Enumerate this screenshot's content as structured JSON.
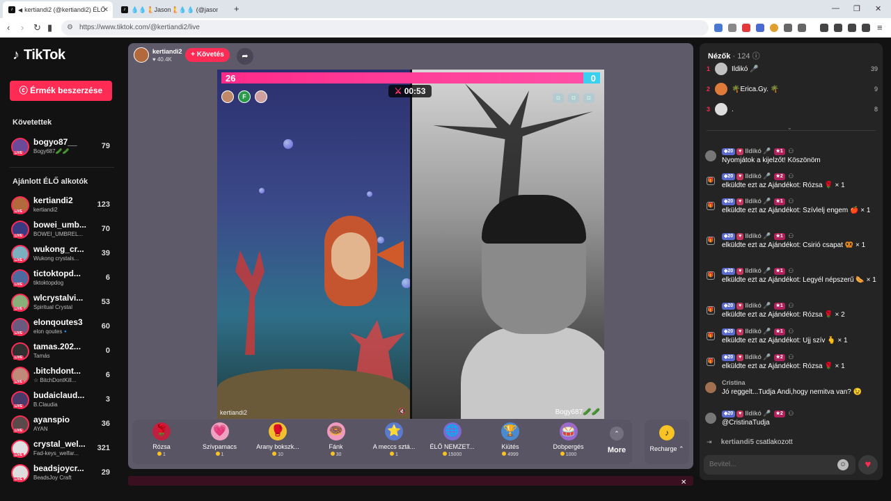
{
  "browser": {
    "tabs": [
      {
        "title": "kertiandi2 (@kertiandi2) ÉLŐ",
        "active": true
      },
      {
        "title": "💧💧🧜Jason🧜💧💧 (@jason_sam",
        "active": false
      }
    ],
    "new_tab": "+",
    "url": "https://www.tiktok.com/@kertiandi2/live",
    "win_min": "—",
    "win_max": "❐",
    "win_close": "✕"
  },
  "sidebar": {
    "logo": "TikTok",
    "coins_button": "Érmék beszerzése",
    "following_title": "Követettek",
    "following": [
      {
        "name": "bogyo87__",
        "sub": "Bogy687🥒🥒",
        "count": "79",
        "color": "#6c4a9a"
      }
    ],
    "recommended_title": "Ajánlott ÉLŐ alkotók",
    "recommended": [
      {
        "name": "kertiandi2",
        "sub": "kertiandi2",
        "count": "123",
        "color": "#b26a3c"
      },
      {
        "name": "bowei_umb...",
        "sub": "BOWEI_UMBREL...",
        "count": "70",
        "color": "#3a3a80"
      },
      {
        "name": "wukong_cr...",
        "sub": "Wukong crystals...",
        "count": "39",
        "color": "#7ab0c0"
      },
      {
        "name": "tictoktopd...",
        "sub": "tiktoktopdog",
        "count": "6",
        "color": "#4a6aa0"
      },
      {
        "name": "wlcrystalvi...",
        "sub": "Spiritual Crystal",
        "count": "53",
        "color": "#8ab07a"
      },
      {
        "name": "elonqoutes3",
        "sub": "elon qoutes🔹",
        "count": "60",
        "color": "#6a5a80"
      },
      {
        "name": "tamas.202...",
        "sub": "Tamás",
        "count": "0",
        "color": "#303030"
      },
      {
        "name": ".bitchdont...",
        "sub": "☆ BitchDontKill...",
        "count": "6",
        "color": "#c08a7a"
      },
      {
        "name": "budaiclaud...",
        "sub": "B.Claudia",
        "count": "3",
        "color": "#4a3a6a"
      },
      {
        "name": "ayanspio",
        "sub": "AYAN",
        "count": "36",
        "color": "#5a4a4a"
      },
      {
        "name": "crystal_wel...",
        "sub": "Fad-keys_welfar...",
        "count": "321",
        "color": "#e0e0e0"
      },
      {
        "name": "beadsjoycr...",
        "sub": "BeadsJoy Craft",
        "count": "29",
        "color": "#ddd"
      }
    ]
  },
  "stream": {
    "host_name": "kertiandi2",
    "host_likes": "♥ 40.4K",
    "follow_label": "+ Követés",
    "share_icon": "➦",
    "score_left": "26",
    "score_right": "0",
    "pink_fraction": 0.955,
    "timer": "00:53",
    "timer_icon": "⚔",
    "left_label": "kertiandi2",
    "right_label": "Bogy687🥒🥒",
    "mini_avatars": [
      "",
      "F",
      ""
    ],
    "mini_colors": [
      "#c08a6a",
      "#2a9a4a",
      "#d0a0a0"
    ]
  },
  "gifts": [
    {
      "name": "Rózsa",
      "price": "1",
      "icon": "🌹",
      "bg": "#c02040"
    },
    {
      "name": "Szívpamacs",
      "price": "1",
      "icon": "💗",
      "bg": "#f0a0c0"
    },
    {
      "name": "Arany bokszk...",
      "price": "10",
      "icon": "🥊",
      "bg": "#f0c030"
    },
    {
      "name": "Fánk",
      "price": "30",
      "icon": "🍩",
      "bg": "#f09ac0"
    },
    {
      "name": "A meccs sztá...",
      "price": "1",
      "icon": "⭐",
      "bg": "#5a7ad0"
    },
    {
      "name": "ÉLŐ NEMZET...",
      "price": "15000",
      "icon": "🌐",
      "bg": "#7a6ad0"
    },
    {
      "name": "Kiütés",
      "price": "4999",
      "icon": "🏆",
      "bg": "#4a8ad0"
    },
    {
      "name": "Dobpergés",
      "price": "1000",
      "icon": "🥁",
      "bg": "#9a6ad0"
    }
  ],
  "more_label": "More",
  "more_chevron": "⌃",
  "recharge_label": "Recharge ⌃",
  "recharge_icon": "♪",
  "bottom_close": "✕",
  "chat": {
    "viewers_title": "Nézők",
    "viewers_count": "· 124 ⓘ",
    "top_viewers": [
      {
        "rank": "1",
        "name": "Ildikó 🎤",
        "score": "39",
        "color": "#c0c0c0"
      },
      {
        "rank": "2",
        "name": "🌴Erica.Gy. 🌴",
        "score": "9",
        "color": "#e07a3a"
      },
      {
        "rank": "3",
        "name": ".",
        "score": "8",
        "color": "#ddd"
      }
    ],
    "collapse": "⌄",
    "messages": [
      {
        "type": "user",
        "user": "Ildikó 🎤",
        "level": "20",
        "fan": "",
        "rank": "1",
        "text": "Nyomjátok a kijelzőt! Köszönöm"
      },
      {
        "type": "gift",
        "user": "Ildikó 🎤",
        "level": "20",
        "fan": "",
        "rank": "2",
        "text": "elküldte ezt az Ajándékot: Rózsa 🌹 × 1"
      },
      {
        "type": "gift",
        "user": "Ildikó 🎤",
        "level": "20",
        "fan": "",
        "rank": "1",
        "text": "elküldte ezt az Ajándékot: Szívlelj engem 🍎 × 1"
      },
      {
        "type": "gift",
        "user": "Ildikó 🎤",
        "level": "20",
        "fan": "",
        "rank": "1",
        "text": "elküldte ezt az Ajándékot: Csirió csapat 🥨 × 1"
      },
      {
        "type": "gift",
        "user": "Ildikó 🎤",
        "level": "20",
        "fan": "",
        "rank": "1",
        "text": "elküldte ezt az Ajándékot: Legyél népszerű 🌭 × 1"
      },
      {
        "type": "gift",
        "user": "Ildikó 🎤",
        "level": "20",
        "fan": "",
        "rank": "1",
        "text": "elküldte ezt az Ajándékot: Rózsa 🌹 × 2"
      },
      {
        "type": "gift",
        "user": "Ildikó 🎤",
        "level": "20",
        "fan": "",
        "rank": "1",
        "text": "elküldte ezt az Ajándékot: Ujj szív 🫰 × 1"
      },
      {
        "type": "gift",
        "user": "Ildikó 🎤",
        "level": "20",
        "fan": "",
        "rank": "2",
        "text": "elküldte ezt az Ajándékot: Rózsa 🌹 × 1"
      },
      {
        "type": "plain",
        "user": "Cristina",
        "text": "Jó reggelt...Tudja Andi,hogy nemitva van? 😉"
      },
      {
        "type": "user",
        "user": "Ildikó 🎤",
        "level": "20",
        "fan": "",
        "rank": "2",
        "text": "@CristinaTudja"
      }
    ],
    "join_user": "kertiandi5",
    "join_text": "csatlakozott",
    "input_placeholder": "Bevitel...",
    "emoji_icon": "☺",
    "heart_icon": "♥"
  }
}
